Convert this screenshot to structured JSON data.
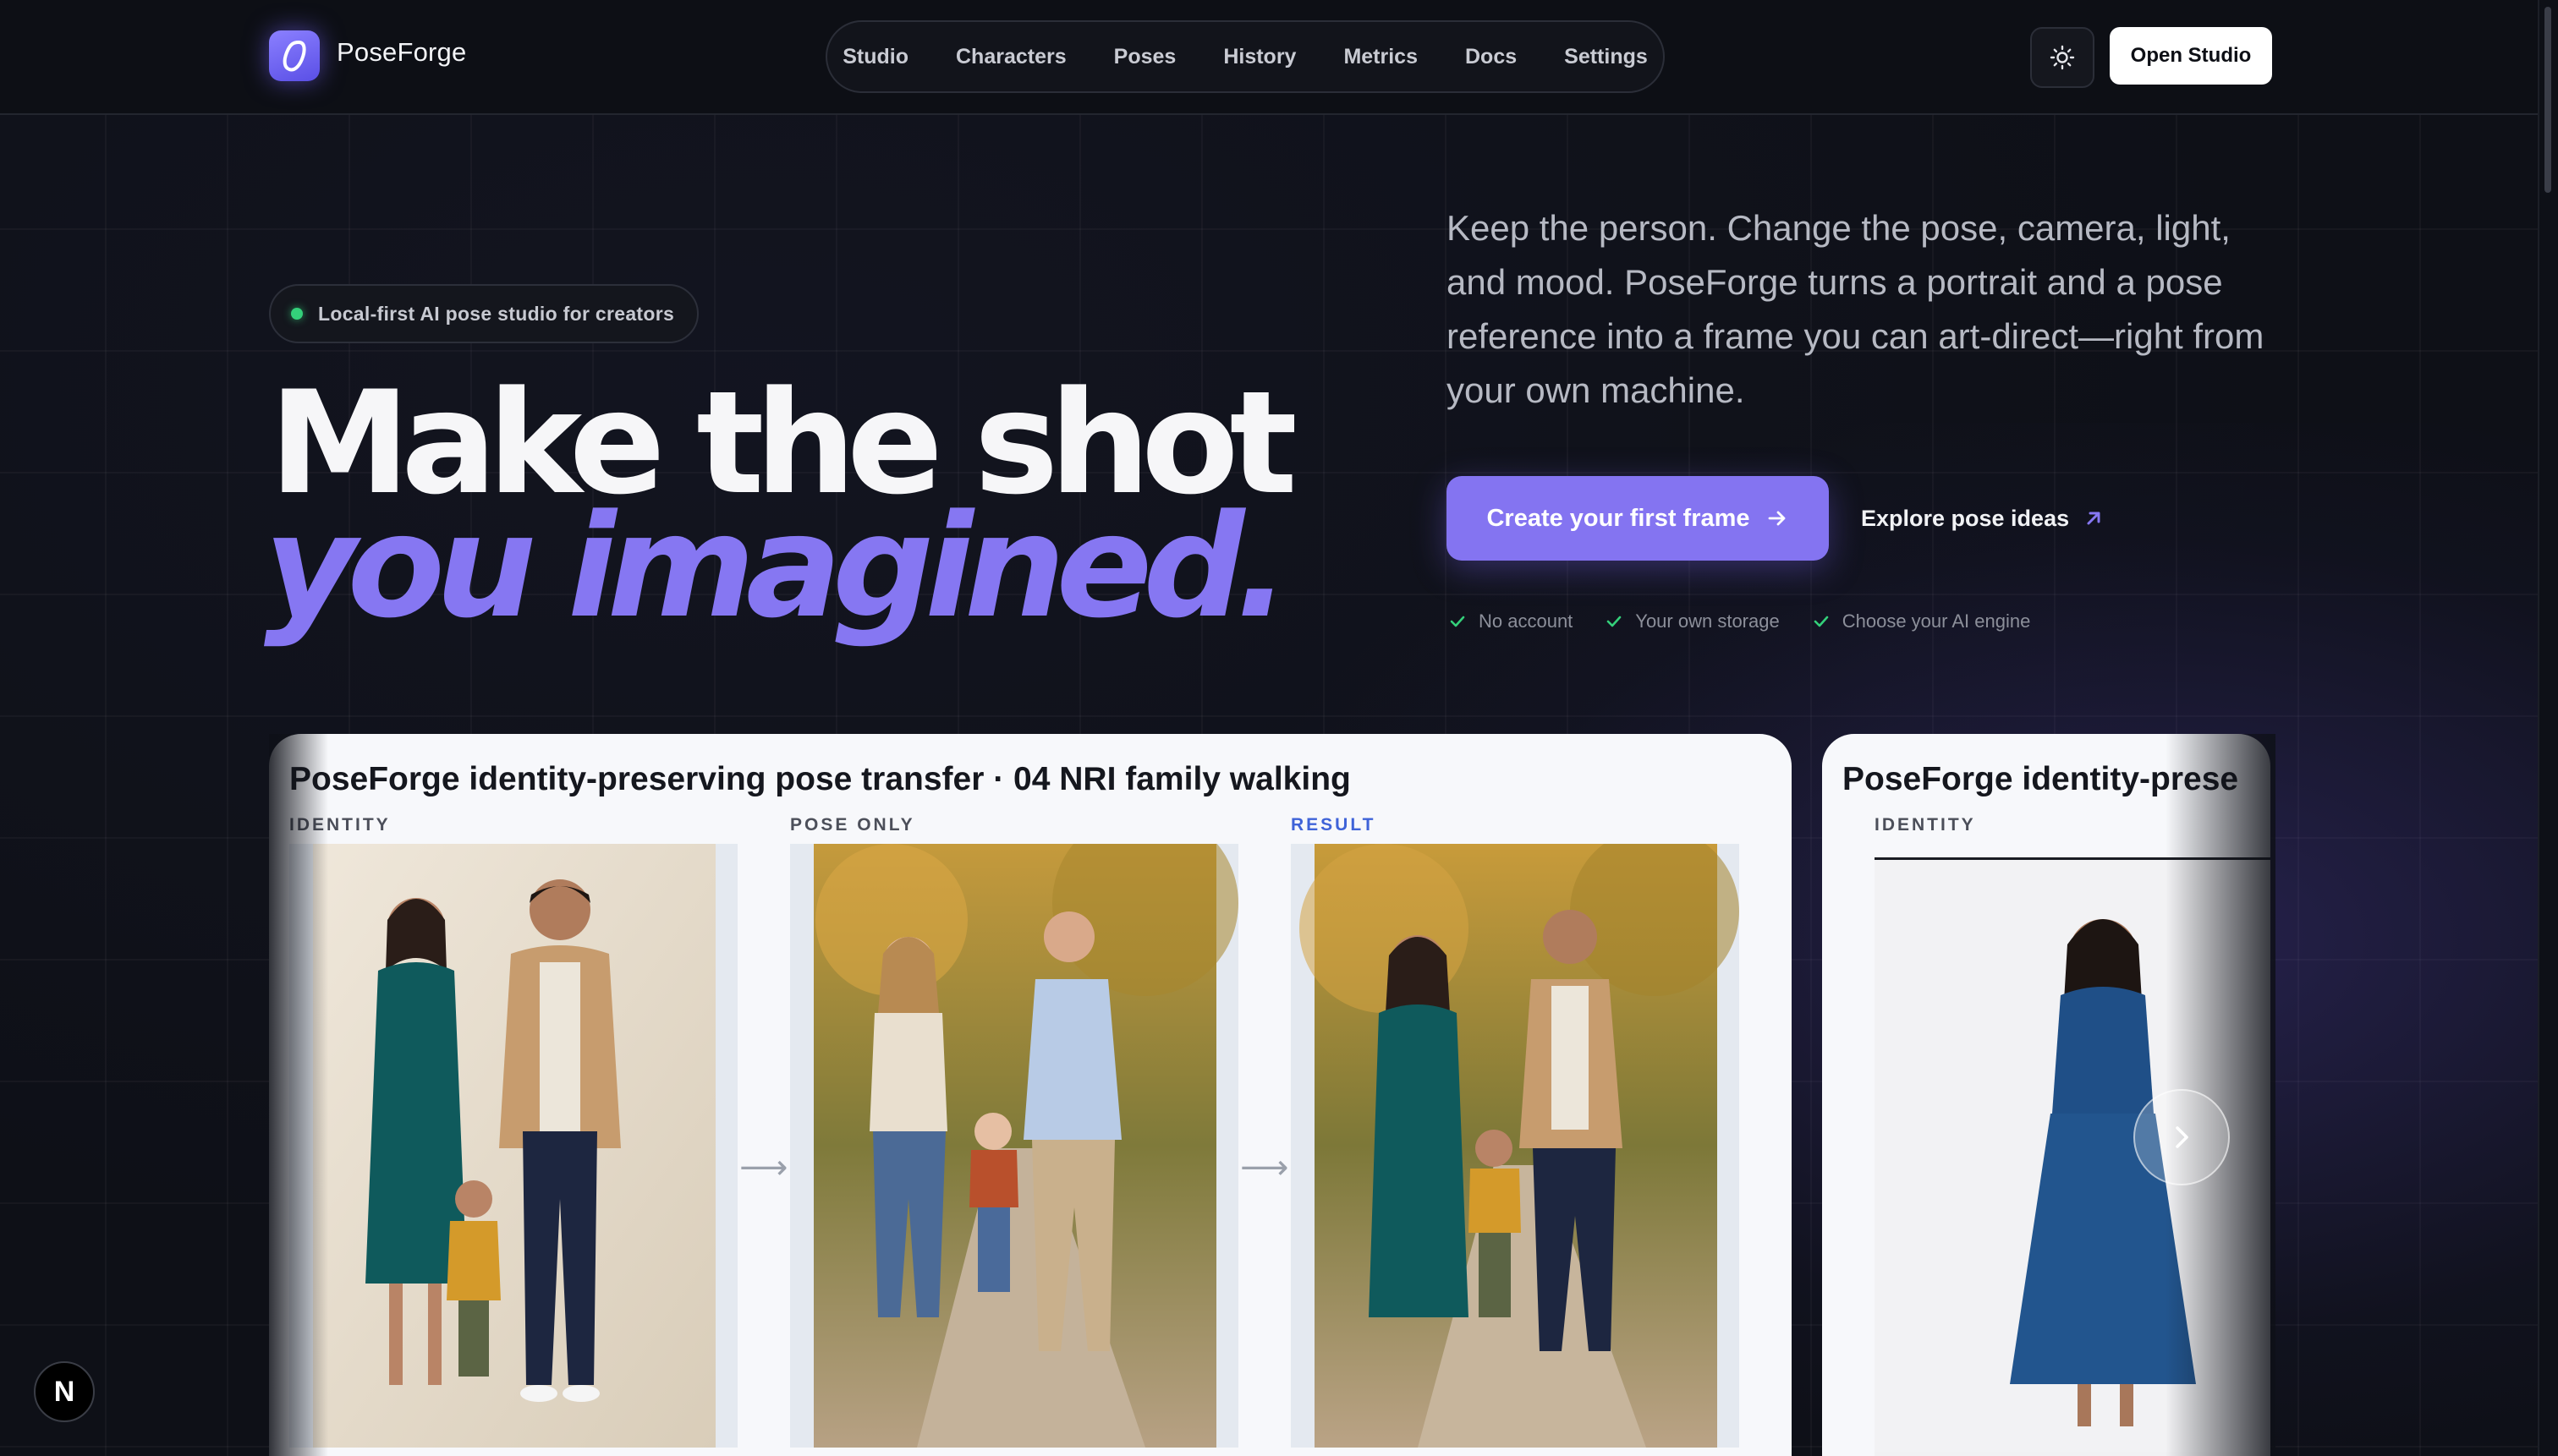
{
  "nav": {
    "brand": "PoseForge",
    "links": [
      "Studio",
      "Characters",
      "Poses",
      "History",
      "Metrics",
      "Docs",
      "Settings"
    ],
    "open_studio": "Open Studio",
    "theme_icon": "sun-icon"
  },
  "hero": {
    "badge": "Local-first AI pose studio for creators",
    "headline_line1": "Make the shot",
    "headline_line2": "you imagined.",
    "lede": "Keep the person. Change the pose, camera, light, and mood. PoseForge turns a portrait and a pose reference into a frame you can art-direct—right from your own machine.",
    "cta_primary": "Create your first frame",
    "cta_secondary": "Explore pose ideas",
    "perks": [
      "No account",
      "Your own storage",
      "Choose your AI engine"
    ]
  },
  "showcase": {
    "main_card": {
      "title": "PoseForge identity-preserving pose transfer · 04 NRI family walking",
      "labels": {
        "identity": "IDENTITY",
        "pose": "POSE ONLY",
        "result": "RESULT"
      }
    },
    "next_card": {
      "title": "PoseForge identity-prese",
      "label": "IDENTITY"
    }
  },
  "colors": {
    "accent": "#8677f2",
    "background": "#0e1017",
    "result_label": "#3f63d8",
    "perk_check": "#34d07a"
  }
}
